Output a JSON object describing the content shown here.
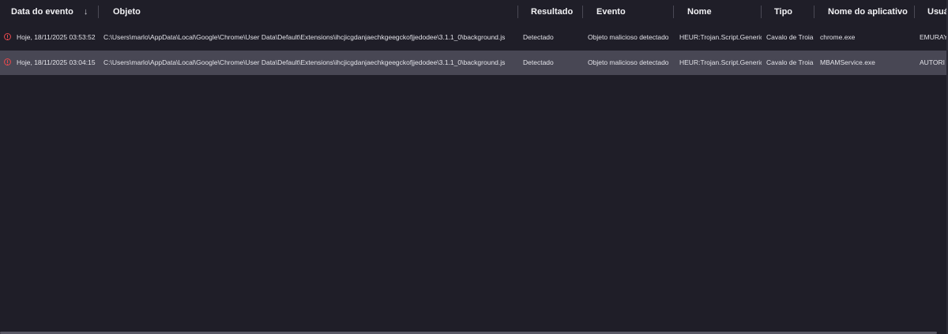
{
  "columns": {
    "date": "Data do evento",
    "object": "Objeto",
    "result": "Resultado",
    "event": "Evento",
    "name": "Nome",
    "type": "Tipo",
    "app_name": "Nome do aplicativo",
    "user": "Usuá"
  },
  "sort": {
    "column": "date",
    "direction": "descending",
    "icon": "arrow-down-icon",
    "glyph": "↓"
  },
  "rows": [
    {
      "status_icon": "warning-circle-icon",
      "date": "Hoje, 18/11/2025 03:53:52",
      "object": "C:\\Users\\marlo\\AppData\\Local\\Google\\Chrome\\User Data\\Default\\Extensions\\ihcjicgdanjaechkgeegckofjjedodee\\3.1.1_0\\background.js",
      "result": "Detectado",
      "event": "Objeto malicioso detectado",
      "name": "HEUR:Trojan.Script.Generic",
      "type": "Cavalo de Troia",
      "app_name": "chrome.exe",
      "user": "EMURAY"
    },
    {
      "status_icon": "warning-circle-icon",
      "date": "Hoje, 18/11/2025 03:04:15",
      "object": "C:\\Users\\marlo\\AppData\\Local\\Google\\Chrome\\User Data\\Default\\Extensions\\ihcjicgdanjaechkgeegckofjjedodee\\3.1.1_0\\background.js",
      "result": "Detectado",
      "event": "Objeto malicioso detectado",
      "name": "HEUR:Trojan.Script.Generic",
      "type": "Cavalo de Troia",
      "app_name": "MBAMService.exe",
      "user": "AUTORI"
    }
  ],
  "colors": {
    "background": "#1f1e28",
    "selected_row": "#484754",
    "warning": "#e5484d"
  }
}
